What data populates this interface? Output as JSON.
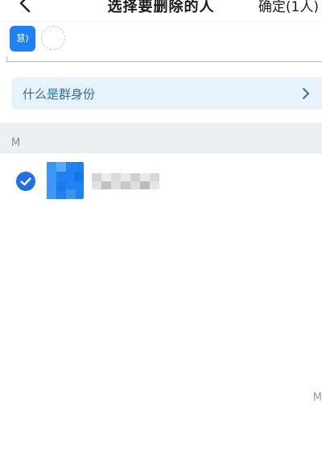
{
  "nav": {
    "title": "选择要删除的人",
    "confirm_label": "确定(1人)"
  },
  "selected": {
    "chip_text": "慧)"
  },
  "info_banner": {
    "text": "什么是群身份"
  },
  "section": {
    "letter": "M"
  },
  "member": {
    "checked": true
  },
  "index_bar": {
    "letter": "M"
  },
  "colors": {
    "accent": "#1f6fe5",
    "banner_bg": "#e6f2fc",
    "banner_text": "#2e6ea8",
    "section_bg": "#eeeff1"
  }
}
